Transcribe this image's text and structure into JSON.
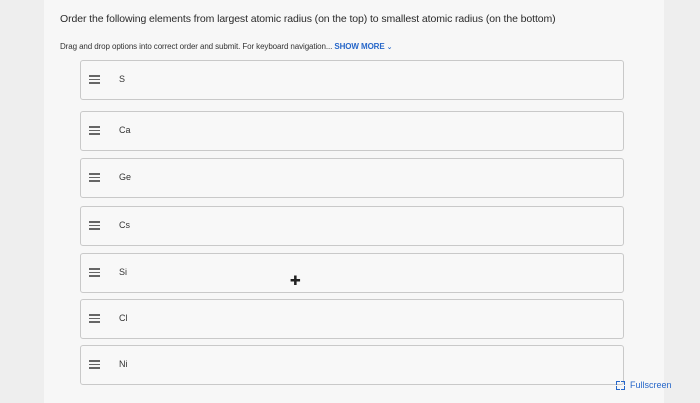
{
  "question": "Order the following elements from largest atomic radius (on the top) to smallest atomic radius (on the bottom)",
  "instructions": "Drag and drop options into correct order and submit. For keyboard navigation...",
  "show_more": "SHOW MORE",
  "items": [
    {
      "label": "S"
    },
    {
      "label": "Ca"
    },
    {
      "label": "Ge"
    },
    {
      "label": "Cs"
    },
    {
      "label": "Si"
    },
    {
      "label": "Cl"
    },
    {
      "label": "Ni"
    }
  ],
  "fullscreen_label": "Fullscreen",
  "colors": {
    "link": "#2767c9",
    "border": "#c9c9c9",
    "background": "#eeeeee"
  }
}
